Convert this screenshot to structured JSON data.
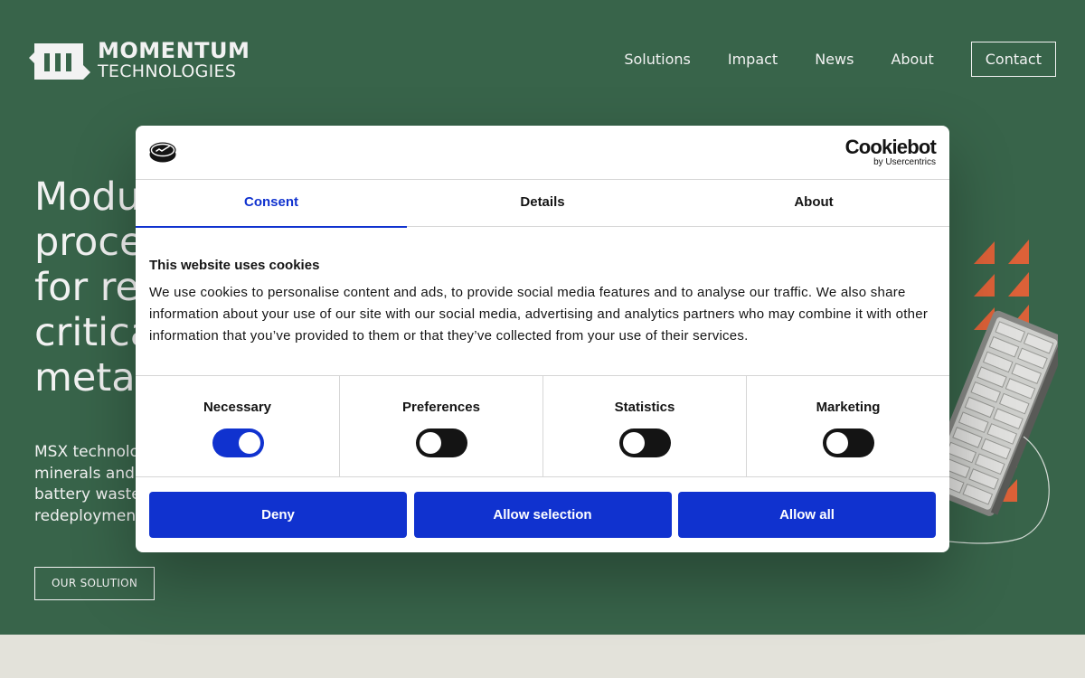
{
  "site": {
    "logo": {
      "line1": "MOMENTUM",
      "line2": "TECHNOLOGIES"
    },
    "nav": [
      {
        "label": "Solutions"
      },
      {
        "label": "Impact"
      },
      {
        "label": "News"
      },
      {
        "label": "About"
      }
    ],
    "contact_label": "Contact",
    "hero": {
      "title_lines": [
        "Modu",
        "proce",
        "for rec",
        "critica",
        "metals"
      ],
      "body_lines": [
        "MSX technolo",
        "minerals and",
        "battery waste",
        "redeployment"
      ],
      "button_label": "OUR SOLUTION"
    },
    "colors": {
      "hero_bg": "#3c6a4f",
      "accent_orange": "#e8673c",
      "page_bg": "#f0efe6"
    }
  },
  "cookie_dialog": {
    "brand": {
      "name": "Cookiebot",
      "sub": "by Usercentrics"
    },
    "tabs": [
      {
        "label": "Consent",
        "active": true
      },
      {
        "label": "Details",
        "active": false
      },
      {
        "label": "About",
        "active": false
      }
    ],
    "title": "This website uses cookies",
    "body": "We use cookies to personalise content and ads, to provide social media features and to analyse our traffic. We also share information about your use of our site with our social media, advertising and analytics partners who may combine it with other information that you’ve provided to them or that they’ve collected from your use of their services.",
    "toggles": [
      {
        "label": "Necessary",
        "on": true
      },
      {
        "label": "Preferences",
        "on": false
      },
      {
        "label": "Statistics",
        "on": false
      },
      {
        "label": "Marketing",
        "on": false
      }
    ],
    "buttons": {
      "deny": "Deny",
      "allow_selection": "Allow selection",
      "allow_all": "Allow all"
    },
    "accent": "#1032cf"
  }
}
